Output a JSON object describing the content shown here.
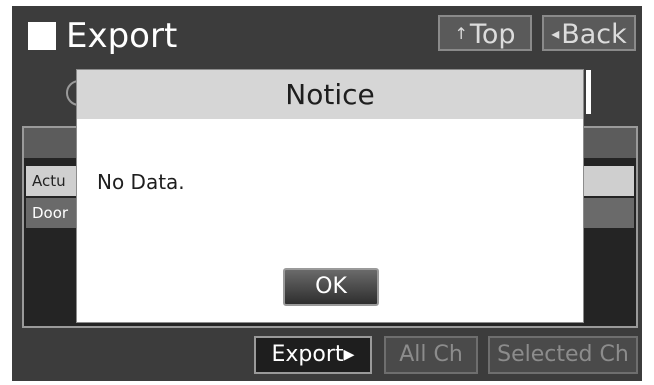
{
  "header": {
    "title": "Export",
    "top_label": "Top",
    "back_label": "Back",
    "top_arrow": "↑",
    "back_arrow": "◂"
  },
  "list": {
    "rows": [
      "Actu",
      "Door"
    ]
  },
  "footer": {
    "export_label": "Export",
    "export_arrow": "▸",
    "all_ch_label": "All Ch",
    "selected_ch_label": "Selected Ch"
  },
  "dialog": {
    "title": "Notice",
    "message": "No Data.",
    "ok_label": "OK"
  },
  "colors": {
    "screen_bg": "#3c3c3c",
    "dialog_header_bg": "#d6d6d6",
    "selected_row_bg": "#cfcfcf",
    "disabled_text": "#8c8c8c"
  }
}
